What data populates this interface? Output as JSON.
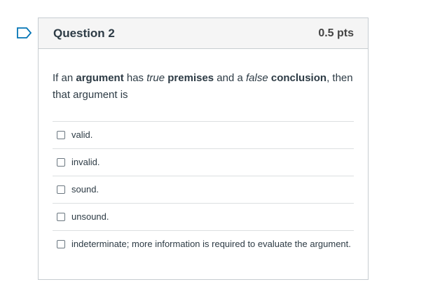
{
  "question": {
    "title": "Question 2",
    "points": "0.5 pts",
    "text_parts": {
      "p1": "If an ",
      "p2": "argument",
      "p3": " has ",
      "p4": "true",
      "p5": " ",
      "p6": "premises",
      "p7": " and a ",
      "p8": "false",
      "p9": " ",
      "p10": "conclusion",
      "p11": ", then that argument is"
    },
    "answers": [
      {
        "label": "valid."
      },
      {
        "label": "invalid."
      },
      {
        "label": "sound."
      },
      {
        "label": "unsound."
      },
      {
        "label": "indeterminate; more information is required to evaluate the argument."
      }
    ]
  },
  "colors": {
    "flag": "#0374b5",
    "header_bg": "#f5f5f5",
    "border": "#c7cdd1",
    "text": "#2d3b45"
  },
  "icons": {
    "flag": "bookmark-flag-icon",
    "checkbox": "checkbox-unchecked"
  }
}
